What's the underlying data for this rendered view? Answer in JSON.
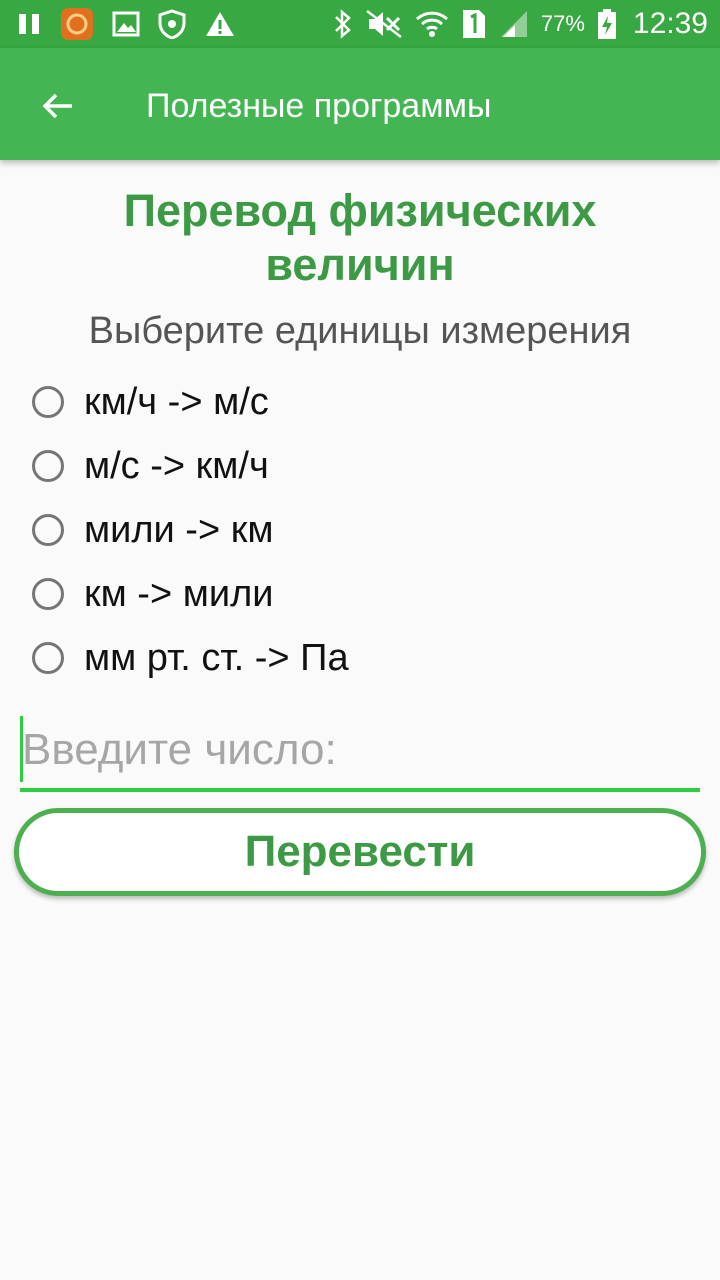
{
  "status_bar": {
    "left_icons": [
      "pause-icon",
      "app-notification-icon",
      "image-icon",
      "shield-icon",
      "warning-icon"
    ],
    "right_icons": [
      "bluetooth-icon",
      "mute-icon",
      "wifi-icon",
      "sim-1-icon",
      "signal-icon",
      "battery-charging-icon"
    ],
    "battery": "77%",
    "time": "12:39"
  },
  "app_bar": {
    "title": "Полезные программы"
  },
  "main": {
    "heading_line1": "Перевод физических",
    "heading_line2": "величин",
    "subheading": "Выберите единицы измерения",
    "options": [
      {
        "label": "км/ч -> м/с"
      },
      {
        "label": "м/с -> км/ч"
      },
      {
        "label": "мили -> км"
      },
      {
        "label": "км -> мили"
      },
      {
        "label": "мм рт. ст. -> Па"
      }
    ],
    "input": {
      "value": "",
      "placeholder": "Введите число:"
    },
    "convert_button": "Перевести"
  },
  "colors": {
    "status_bar": "#37a842",
    "app_bar": "#43b653",
    "accent": "#3d9a44",
    "input_underline": "#2ecc40",
    "button_border": "#4caf50"
  }
}
